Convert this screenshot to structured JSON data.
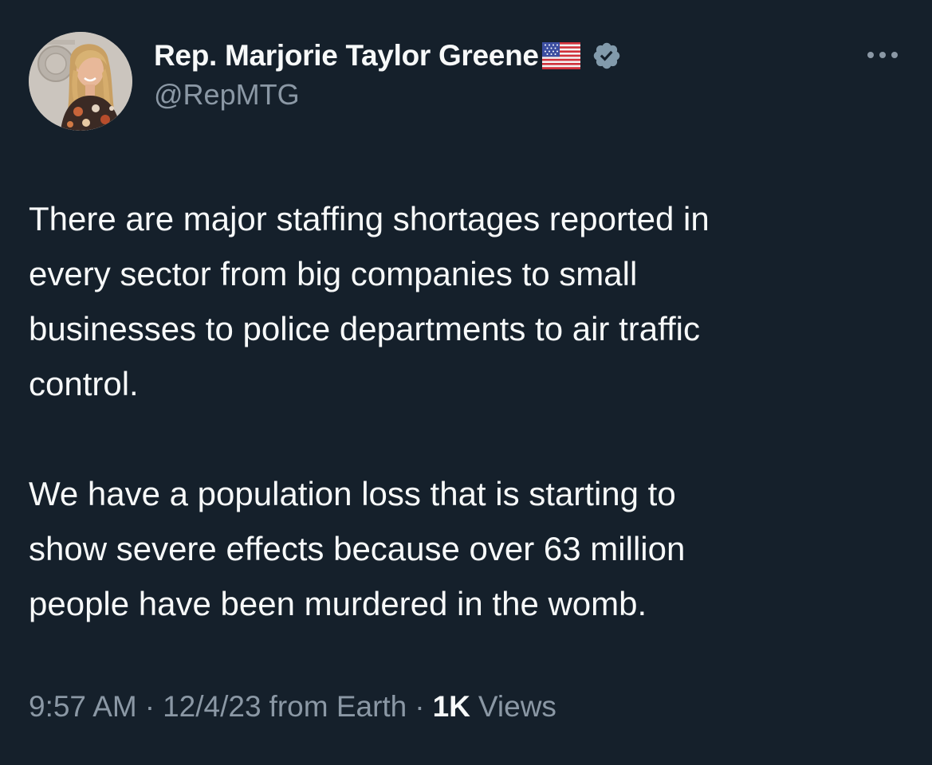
{
  "colors": {
    "background": "#15202b",
    "primary_text": "#f7f9f9",
    "secondary_text": "#8b98a5",
    "verified_badge": "#829aab"
  },
  "author": {
    "display_name": "Rep. Marjorie Taylor Greene",
    "flag_icon": "us-flag-icon",
    "badge_icon": "verified-badge-icon",
    "handle": "@RepMTG"
  },
  "menu": {
    "icon": "more-options-icon"
  },
  "tweet": {
    "paragraphs": [
      "There are major staffing shortages reported in\nevery sector from big companies to small\nbusinesses to police departments to air traffic\ncontrol.",
      "We have a population loss that is starting to\nshow severe effects because over 63 million\npeople have been murdered in the womb."
    ]
  },
  "meta": {
    "time": "9:57 AM",
    "date": "12/4/23",
    "source": "from Earth",
    "separator": "·",
    "views_count": "1K",
    "views_label": "Views"
  }
}
